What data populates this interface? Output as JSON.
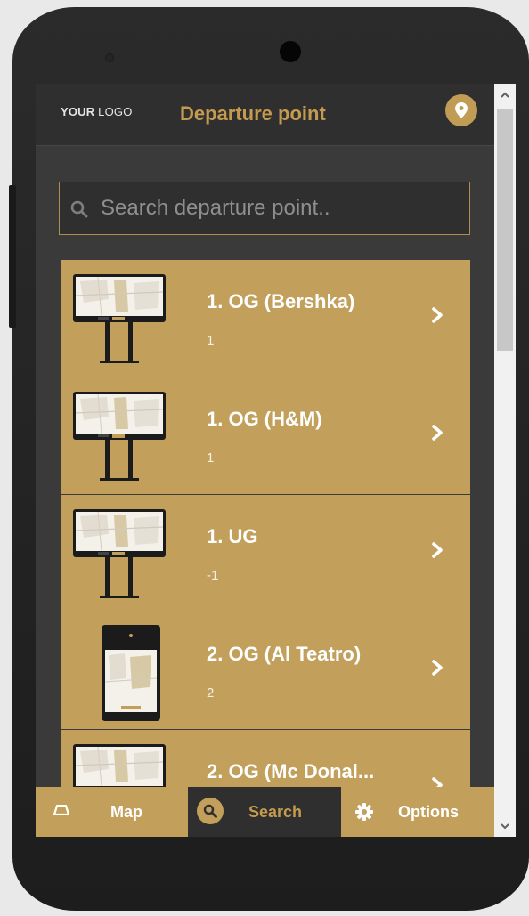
{
  "app": {
    "logo_bold": "YOUR",
    "logo_rest": " LOGO",
    "title": "Departure point"
  },
  "search": {
    "placeholder": "Search departure point..",
    "value": ""
  },
  "items": [
    {
      "name": "1. OG (Bershka)",
      "sub": "1",
      "device": "kiosk-landscape"
    },
    {
      "name": "1. OG (H&M)",
      "sub": "1",
      "device": "kiosk-landscape"
    },
    {
      "name": "1. UG",
      "sub": "-1",
      "device": "kiosk-landscape"
    },
    {
      "name": "2. OG (Al Teatro)",
      "sub": "2",
      "device": "tablet-portrait"
    },
    {
      "name": "2. OG (Mc Donal...",
      "sub": "",
      "device": "kiosk-landscape"
    }
  ],
  "tabs": [
    {
      "label": "Map",
      "icon": "map-icon"
    },
    {
      "label": "Search",
      "icon": "search-icon"
    },
    {
      "label": "Options",
      "icon": "gear-icon"
    }
  ],
  "colors": {
    "accent": "#c2a05b",
    "title": "#c49a4f",
    "background": "#3a3a3a",
    "header": "#2f2f2f"
  }
}
